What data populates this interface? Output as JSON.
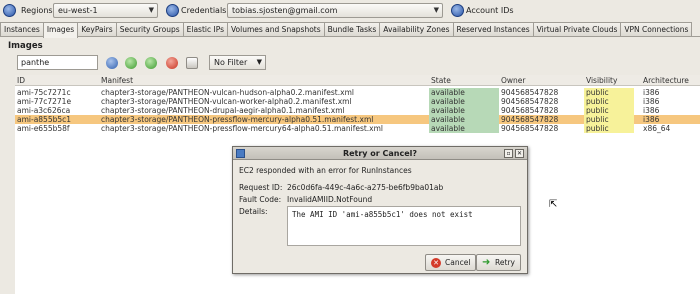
{
  "toolbar": {
    "regions_label": "Regions",
    "region_value": "eu-west-1",
    "credentials_label": "Credentials",
    "credentials_value": "tobias.sjosten@gmail.com",
    "account_ids_label": "Account IDs"
  },
  "tabs": [
    "Instances",
    "Images",
    "KeyPairs",
    "Security Groups",
    "Elastic IPs",
    "Volumes and Snapshots",
    "Bundle Tasks",
    "Availability Zones",
    "Reserved Instances",
    "Virtual Private Clouds",
    "VPN Connections"
  ],
  "active_tab": "Images",
  "section_title": "Images",
  "search": {
    "value": "panthe"
  },
  "filter": {
    "value": "No Filter"
  },
  "table": {
    "columns": [
      "ID",
      "Manifest",
      "State",
      "Owner",
      "Visibility",
      "Architecture"
    ],
    "rows": [
      [
        "ami-75c7271c",
        "chapter3-storage/PANTHEON-vulcan-hudson-alpha0.2.manifest.xml",
        "available",
        "904568547828",
        "public",
        "i386"
      ],
      [
        "ami-77c7271e",
        "chapter3-storage/PANTHEON-vulcan-worker-alpha0.2.manifest.xml",
        "available",
        "904568547828",
        "public",
        "i386"
      ],
      [
        "ami-a3c626ca",
        "chapter3-storage/PANTHEON-drupal-aegir-alpha0.1.manifest.xml",
        "available",
        "904568547828",
        "public",
        "i386"
      ],
      [
        "ami-a855b5c1",
        "chapter3-storage/PANTHEON-pressflow-mercury-alpha0.51.manifest.xml",
        "available",
        "904568547828",
        "public",
        "i386"
      ],
      [
        "ami-e655b58f",
        "chapter3-storage/PANTHEON-pressflow-mercury64-alpha0.51.manifest.xml",
        "available",
        "904568547828",
        "public",
        "x86_64"
      ]
    ],
    "selected_row": 3
  },
  "dialog": {
    "title": "Retry or Cancel?",
    "intro": "EC2 responded with an error for RunInstances",
    "request_id_label": "Request ID:",
    "request_id": "26c0d6fa-449c-4a6c-a275-be6fb9ba01ab",
    "fault_code_label": "Fault Code:",
    "fault_code": "InvalidAMIID.NotFound",
    "details_label": "Details:",
    "details": "The AMI ID 'ami-a855b5c1' does not exist",
    "cancel_label": "Cancel",
    "retry_label": "Retry"
  },
  "colors": {
    "state_bg": "#b7d9b7",
    "visibility_bg": "#f7f29a",
    "selected_row": "#f6c77f"
  }
}
